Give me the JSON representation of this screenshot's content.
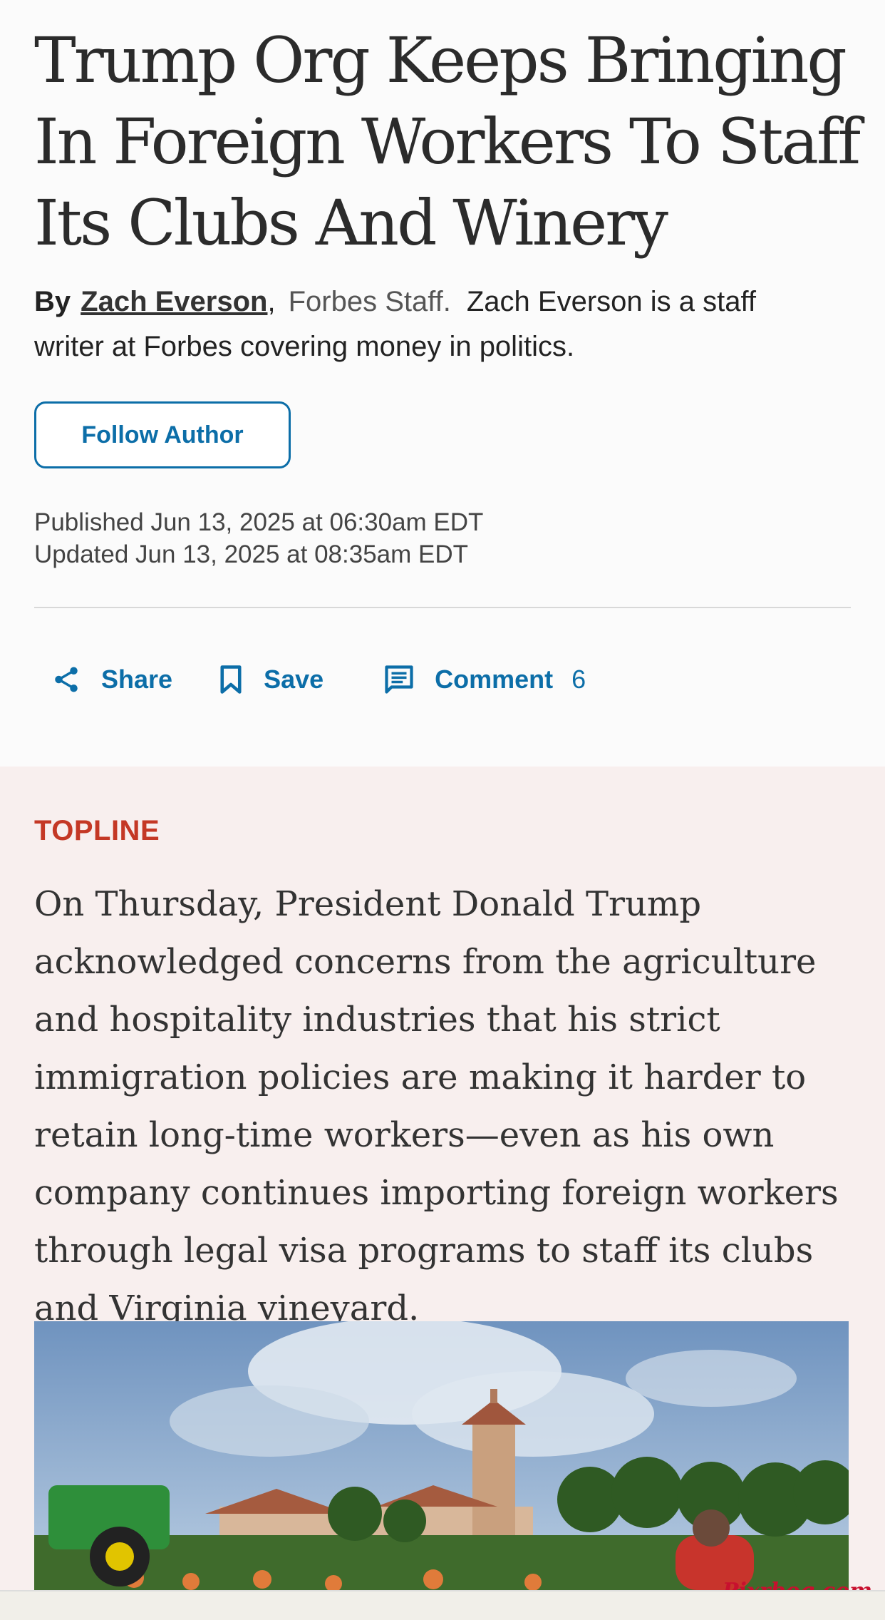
{
  "article": {
    "title": "Trump Org Keeps Bringing In Foreign Workers To Staff Its Clubs And Winery",
    "byline": {
      "by_label": "By",
      "author_name": "Zach Everson",
      "comma": ",",
      "staff_label": "Forbes Staff.",
      "bio": "Zach Everson is a staff writer at Forbes covering money in politics."
    },
    "follow_button_label": "Follow Author",
    "published": "Published Jun 13, 2025 at 06:30am EDT",
    "updated": "Updated Jun 13, 2025 at 08:35am EDT",
    "actions": {
      "share_label": "Share",
      "save_label": "Save",
      "comment_label": "Comment",
      "comment_count": "6"
    }
  },
  "topline": {
    "label": "TOPLINE",
    "text": "On Thursday, President Donald Trump acknowledged concerns from the agriculture and hospitality industries that his strict immigration policies are making it harder to retain long-time workers—even as his own company continues importing foreign workers through legal visa programs to staff its clubs and Virginia vineyard."
  },
  "watermark": "Pixrbog.com",
  "colors": {
    "accent": "#0c6ea8",
    "topline_label": "#c43825",
    "topline_bg": "#f8efee"
  },
  "icons": [
    "share-icon",
    "bookmark-icon",
    "comment-icon"
  ]
}
